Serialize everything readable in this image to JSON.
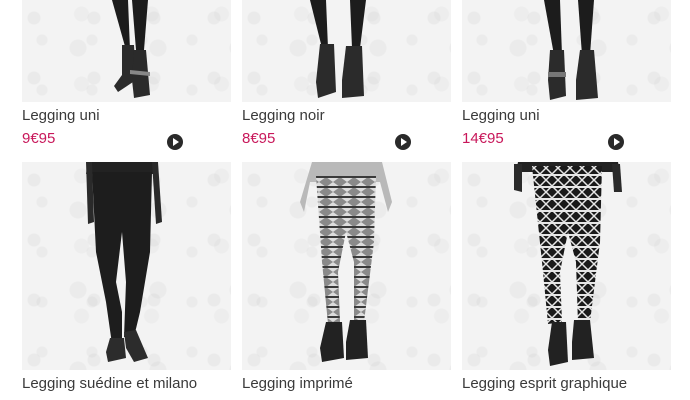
{
  "products": [
    {
      "name": "Legging uni",
      "price": "9€95",
      "image": "black-leggings-boots",
      "action_icon": "play-icon"
    },
    {
      "name": "Legging noir",
      "price": "8€95",
      "image": "black-leggings-boots",
      "action_icon": "play-icon"
    },
    {
      "name": "Legging uni",
      "price": "14€95",
      "image": "black-leggings-boots",
      "action_icon": "play-icon"
    },
    {
      "name": "Legging suédine et milano",
      "image": "black-suede-leggings-model"
    },
    {
      "name": "Legging imprimé",
      "image": "grey-printed-leggings-model"
    },
    {
      "name": "Legging esprit graphique",
      "image": "black-white-graphic-leggings-model"
    }
  ],
  "colors": {
    "price": "#c8175a",
    "name": "#3a3a3a",
    "photo_bg": "#f3f3f3"
  }
}
